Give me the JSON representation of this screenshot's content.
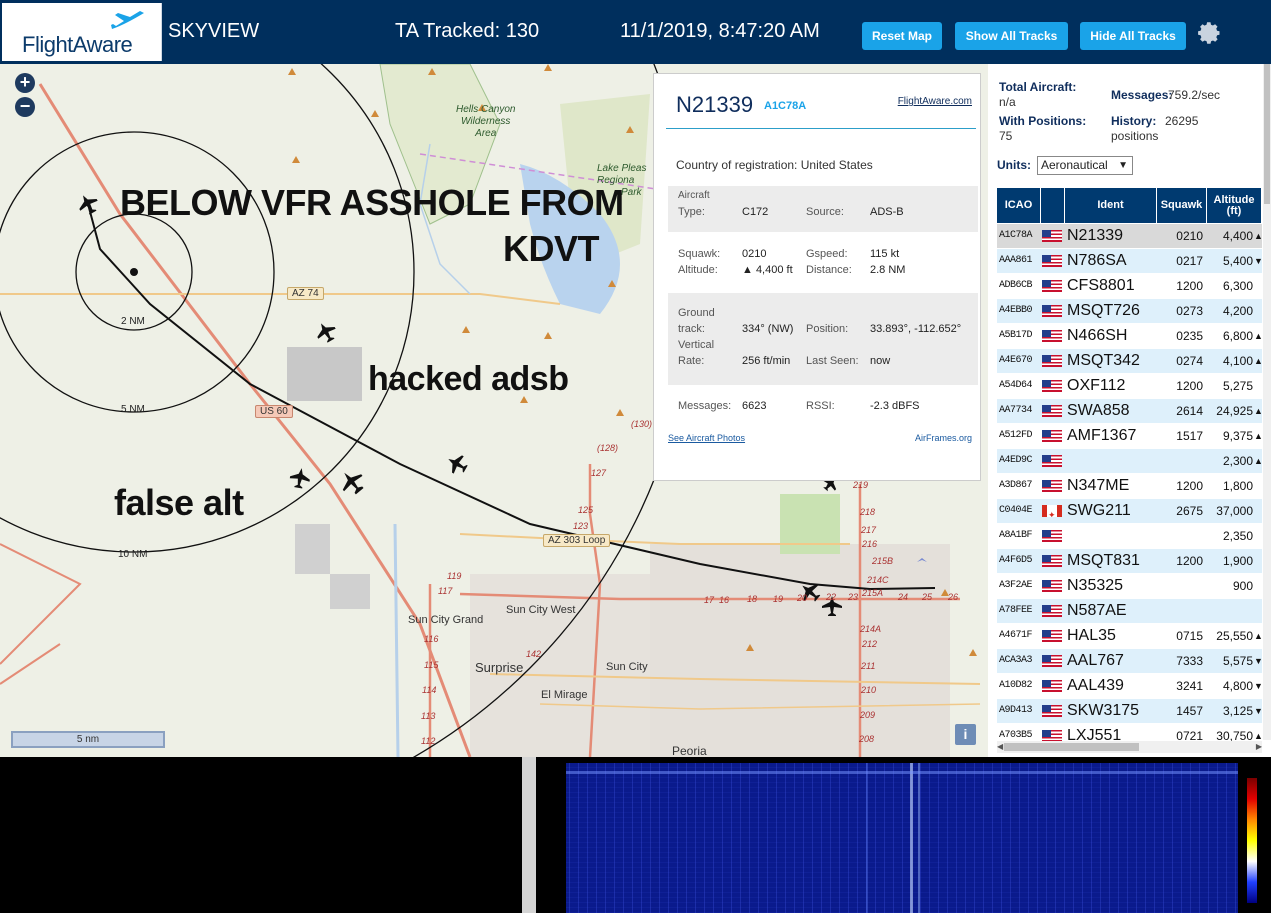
{
  "header": {
    "logo_text": "FlightAware",
    "app_name": "SKYVIEW",
    "tracked": "TA Tracked: 130",
    "clock": "11/1/2019, 8:47:20 AM",
    "btn_reset": "Reset Map",
    "btn_show": "Show All Tracks",
    "btn_hide": "Hide All Tracks",
    "accent": "#1aa3e8",
    "bar_color": "#002f5d"
  },
  "map": {
    "zoom_in": "+",
    "zoom_out": "−",
    "scale": "5 nm",
    "info": "i",
    "rings": {
      "r2": "2 NM",
      "r5": "5 NM",
      "r10": "10 NM"
    },
    "annotations": {
      "a1": "BELOW VFR ASSHOLE FROM",
      "a1b": "KDVT",
      "a2": "hacked adsb",
      "a3": "false alt"
    },
    "labels": {
      "hells_canyon": "Hells Canyon Wilderness Area",
      "hells_1": "Hells Canyon",
      "hells_2": "Wilderness",
      "hells_3": "Area",
      "lake_1": "Lake Pleas",
      "lake_2": "Regiona",
      "lake_3": "Park",
      "sun_city_grand": "Sun City Grand",
      "sun_city_west": "Sun City West",
      "surprise": "Surprise",
      "sun_city": "Sun City",
      "el_mirage": "El Mirage",
      "peoria": "Peoria",
      "az74": "AZ 74",
      "us60": "US 60",
      "az303": "AZ 303 Loop",
      "n128": "(128)",
      "n130": "(130)",
      "n127": "127",
      "n125": "125",
      "n123": "123",
      "n119": "119",
      "n117": "117",
      "n116": "116",
      "n115": "115",
      "n114": "114",
      "n113": "113",
      "n112": "112",
      "n142": "142",
      "n219": "219",
      "n218": "218",
      "n217": "217",
      "n216": "216",
      "n215b": "215B",
      "n214c": "214C",
      "n215a": "215A",
      "n214a": "214A",
      "n212": "212",
      "n211": "211",
      "n210": "210",
      "n209": "209",
      "n208": "208",
      "n17": "17",
      "n16": "16",
      "n18": "18",
      "n19": "19",
      "n20": "20",
      "n22": "22",
      "n23": "23",
      "n24": "24",
      "n25": "25",
      "n26": "26"
    }
  },
  "popup": {
    "registration": "N21339",
    "icao": "A1C78A",
    "fa_link": "FlightAware.com",
    "country_label": "Country of registration:",
    "country_value": "United States",
    "aircraft_type_label1": "Aircraft",
    "aircraft_type_label2": "Type:",
    "aircraft_type_value": "C172",
    "source_label": "Source:",
    "source_value": "ADS-B",
    "squawk_label": "Squawk:",
    "squawk_value": "0210",
    "gspeed_label": "Gspeed:",
    "gspeed_value": "115 kt",
    "altitude_label": "Altitude:",
    "altitude_value": "▲ 4,400 ft",
    "distance_label": "Distance:",
    "distance_value": "2.8 NM",
    "track_label1": "Ground",
    "track_label2": "track:",
    "track_value": "334° (NW)",
    "position_label": "Position:",
    "position_value": "33.893°, -112.652°",
    "vrate_label1": "Vertical",
    "vrate_label2": "Rate:",
    "vrate_value": "256 ft/min",
    "lastseen_label": "Last Seen:",
    "lastseen_value": "now",
    "messages_label": "Messages:",
    "messages_value": "6623",
    "rssi_label": "RSSI:",
    "rssi_value": "-2.3 dBFS",
    "photos_link": "See Aircraft Photos",
    "airframes_link": "AirFrames.org"
  },
  "sidebar": {
    "total_label": "Total Aircraft:",
    "total_value": "n/a",
    "messages_label": "Messages:",
    "messages_value": "759.2/sec",
    "positions_label": "With Positions:",
    "positions_value": "75",
    "history_label": "History:",
    "history_value": "26295",
    "history_unit": "positions",
    "units_label": "Units:",
    "units_value": "Aeronautical",
    "columns": {
      "icao": "ICAO",
      "ident": "Ident",
      "squawk": "Squawk",
      "alt1": "Altitude",
      "alt2": "(ft)"
    },
    "rows": [
      {
        "icao": "A1C78A",
        "flag": "us",
        "ident": "N21339",
        "squawk": "0210",
        "alt": "4,400",
        "trend": "▲",
        "selected": true
      },
      {
        "icao": "AAA861",
        "flag": "us",
        "ident": "N786SA",
        "squawk": "0217",
        "alt": "5,400",
        "trend": "▼"
      },
      {
        "icao": "ADB6CB",
        "flag": "us",
        "ident": "CFS8801",
        "squawk": "1200",
        "alt": "6,300",
        "trend": ""
      },
      {
        "icao": "A4EBB0",
        "flag": "us",
        "ident": "MSQT726",
        "squawk": "0273",
        "alt": "4,200",
        "trend": ""
      },
      {
        "icao": "A5B17D",
        "flag": "us",
        "ident": "N466SH",
        "squawk": "0235",
        "alt": "6,800",
        "trend": "▲"
      },
      {
        "icao": "A4E670",
        "flag": "us",
        "ident": "MSQT342",
        "squawk": "0274",
        "alt": "4,100",
        "trend": "▲"
      },
      {
        "icao": "A54D64",
        "flag": "us",
        "ident": "OXF112",
        "squawk": "1200",
        "alt": "5,275",
        "trend": ""
      },
      {
        "icao": "AA7734",
        "flag": "us",
        "ident": "SWA858",
        "squawk": "2614",
        "alt": "24,925",
        "trend": "▲"
      },
      {
        "icao": "A512FD",
        "flag": "us",
        "ident": "AMF1367",
        "squawk": "1517",
        "alt": "9,375",
        "trend": "▲"
      },
      {
        "icao": "A4ED9C",
        "flag": "us",
        "ident": "",
        "squawk": "",
        "alt": "2,300",
        "trend": "▲"
      },
      {
        "icao": "A3D867",
        "flag": "us",
        "ident": "N347ME",
        "squawk": "1200",
        "alt": "1,800",
        "trend": ""
      },
      {
        "icao": "C0404E",
        "flag": "ca",
        "ident": "SWG211",
        "squawk": "2675",
        "alt": "37,000",
        "trend": ""
      },
      {
        "icao": "A8A1BF",
        "flag": "us",
        "ident": "",
        "squawk": "",
        "alt": "2,350",
        "trend": ""
      },
      {
        "icao": "A4F6D5",
        "flag": "us",
        "ident": "MSQT831",
        "squawk": "1200",
        "alt": "1,900",
        "trend": ""
      },
      {
        "icao": "A3F2AE",
        "flag": "us",
        "ident": "N35325",
        "squawk": "",
        "alt": "900",
        "trend": ""
      },
      {
        "icao": "A78FEE",
        "flag": "us",
        "ident": "N587AE",
        "squawk": "",
        "alt": "",
        "trend": ""
      },
      {
        "icao": "A4671F",
        "flag": "us",
        "ident": "HAL35",
        "squawk": "0715",
        "alt": "25,550",
        "trend": "▲"
      },
      {
        "icao": "ACA3A3",
        "flag": "us",
        "ident": "AAL767",
        "squawk": "7333",
        "alt": "5,575",
        "trend": "▼"
      },
      {
        "icao": "A10D82",
        "flag": "us",
        "ident": "AAL439",
        "squawk": "3241",
        "alt": "4,800",
        "trend": "▼"
      },
      {
        "icao": "A9D413",
        "flag": "us",
        "ident": "SKW3175",
        "squawk": "1457",
        "alt": "3,125",
        "trend": "▼"
      },
      {
        "icao": "A703B5",
        "flag": "us",
        "ident": "LXJ551",
        "squawk": "0721",
        "alt": "30,750",
        "trend": "▲"
      }
    ]
  }
}
